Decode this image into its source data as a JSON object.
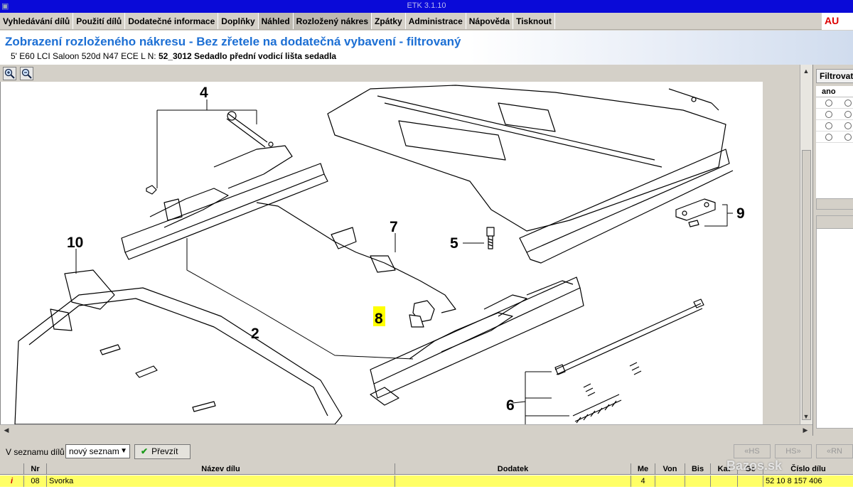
{
  "window": {
    "title": "ETK 3.1.10"
  },
  "menu": {
    "items": [
      {
        "label": "Vyhledávání dílů",
        "active": false
      },
      {
        "label": "Použití dílů",
        "active": false
      },
      {
        "label": "Dodatečné informace",
        "active": false
      },
      {
        "label": "Doplňky",
        "active": false
      },
      {
        "label": "Náhled",
        "active": true
      },
      {
        "label": "Rozložený nákres",
        "active": true
      },
      {
        "label": "Zpátky",
        "active": false
      },
      {
        "label": "Administrace",
        "active": false
      },
      {
        "label": "Nápověda",
        "active": false
      },
      {
        "label": "Tisknout",
        "active": false
      }
    ],
    "logo_text": "AU"
  },
  "header": {
    "title": "Zobrazení rozloženého nákresu - Bez zřetele na dodatečná vybavení - filtrovaný",
    "vehicle": "5' E60 LCI Saloon 520d N47 ECE  L N:",
    "group": "52_3012 Sedadlo přední vodicí lišta sedadla"
  },
  "zoom": {
    "zoom_in_icon": "zoom-in-icon",
    "zoom_out_icon": "zoom-out-icon"
  },
  "diagram": {
    "callouts": [
      {
        "label": "4"
      },
      {
        "label": "10"
      },
      {
        "label": "2"
      },
      {
        "label": "7"
      },
      {
        "label": "5"
      },
      {
        "label": "8",
        "highlighted": true
      },
      {
        "label": "9"
      },
      {
        "label": "6"
      }
    ],
    "highlight_color": "#ffff00"
  },
  "filter_panel": {
    "title": "Filtrovat",
    "column_header": "ano",
    "rows": 4
  },
  "bottom_toolbar": {
    "list_label": "V seznamu dílů",
    "list_value": "nový seznam",
    "accept_label": "Převzít",
    "nav": [
      "«HS",
      "HS»",
      "«RN"
    ]
  },
  "parts_table": {
    "columns": [
      "",
      "Nr",
      "Název dílu",
      "Dodatek",
      "Me",
      "Von",
      "Bis",
      "Kat",
      "Ge",
      "Číslo dílu"
    ],
    "rows": [
      {
        "icon": "i",
        "nr": "08",
        "name": "Svorka",
        "addition": "",
        "qty": "4",
        "from": "",
        "to": "",
        "cat": "",
        "ge": "",
        "part_no": "52 10 8 157 406"
      }
    ]
  },
  "watermark": "Bazos.sk",
  "colors": {
    "title_bar": "#0a0ad8",
    "header_title": "#1c6fd4",
    "row_highlight": "#ffff66"
  }
}
